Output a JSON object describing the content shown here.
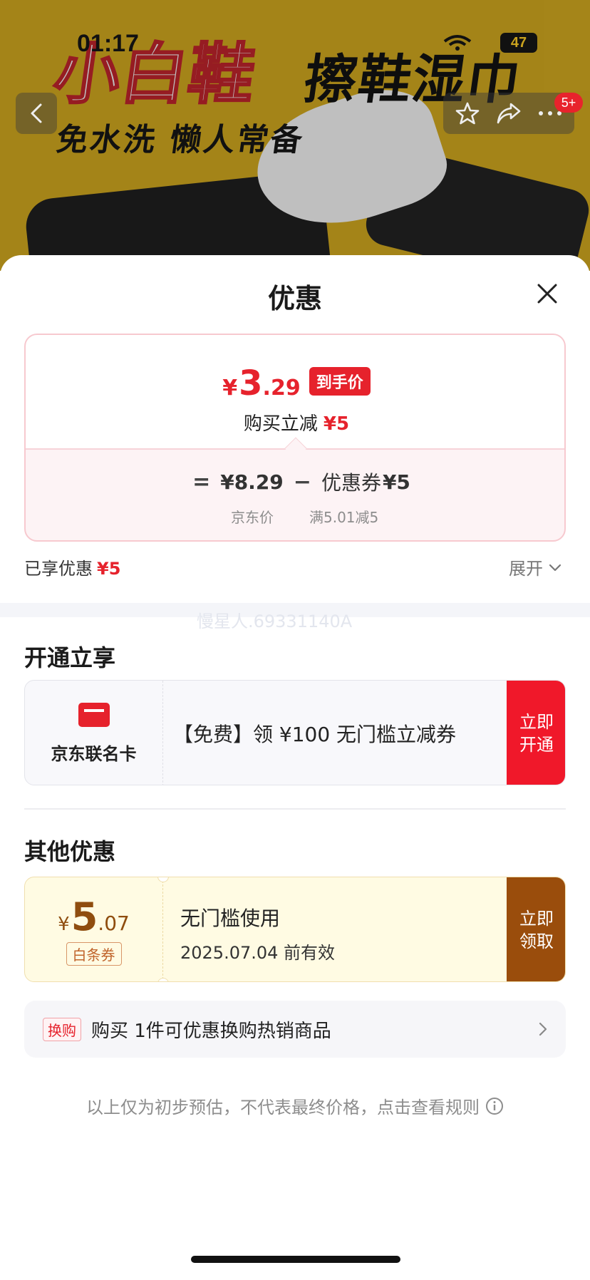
{
  "status_bar": {
    "time": "01:17",
    "battery": "47"
  },
  "banner": {
    "headline_a": "小白鞋",
    "headline_b": "擦鞋湿巾",
    "subline": "免水洗 懒人常备",
    "cart_badge": "5+"
  },
  "sheet": {
    "title": "优惠",
    "price": {
      "currency": "¥",
      "integer": "3",
      "decimal": ".29",
      "tag": "到手价",
      "sub_label": "购买立减",
      "sub_value": "¥5"
    },
    "formula": {
      "equals": "=",
      "jd_price": "¥8.29",
      "minus": "−",
      "coupon_label": "优惠券",
      "coupon_value": "¥5",
      "jd_price_caption": "京东价",
      "coupon_caption": "满5.01减5"
    },
    "enjoyed_label": "已享优惠",
    "enjoyed_value": "¥5",
    "expand_label": "展开",
    "watermark": "慢星人.69331140A"
  },
  "open_section": {
    "heading": "开通立享",
    "card": {
      "name": "京东联名卡",
      "text": "【免费】领 ¥100 无门槛立减券",
      "button": "立即开通",
      "accent": "#f0182a"
    }
  },
  "other_section": {
    "heading": "其他优惠",
    "coupon": {
      "currency": "¥",
      "integer": "5",
      "decimal": ".07",
      "tag": "白条券",
      "title": "无门槛使用",
      "validity": "2025.07.04 前有效",
      "button": "立即领取",
      "accent": "#9a4d0c"
    },
    "exchange": {
      "tag": "换购",
      "text": "购买 1件可优惠换购热销商品"
    }
  },
  "footnote": "以上仅为初步预估，不代表最终价格，点击查看规则",
  "icons": [
    "back-arrow-icon",
    "star-icon",
    "share-icon",
    "more-icon",
    "close-icon",
    "chevron-down-icon",
    "credit-card-icon",
    "chevron-right-icon",
    "info-icon"
  ]
}
